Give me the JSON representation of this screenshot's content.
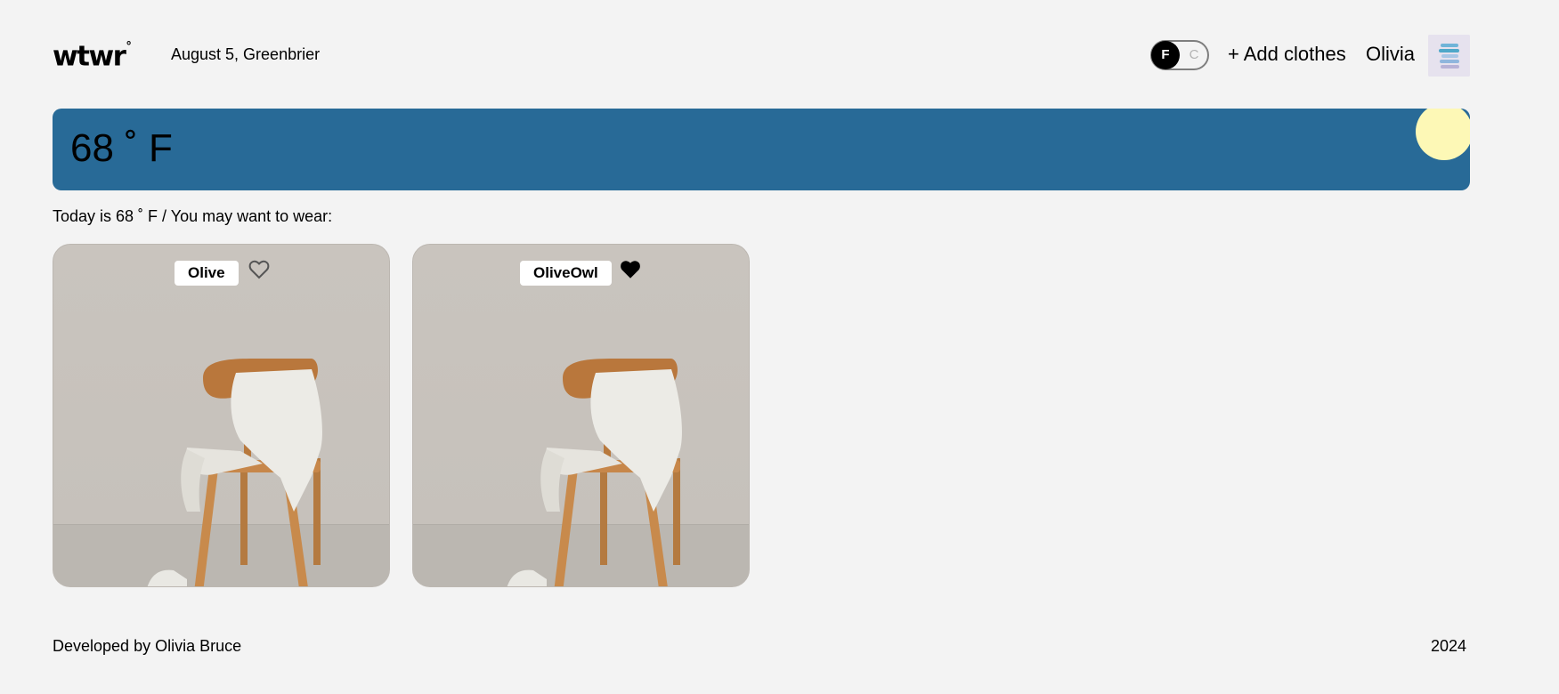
{
  "header": {
    "logo": "wtwr",
    "logo_degree": "°",
    "date_location": "August 5, Greenbrier",
    "unit_toggle": {
      "fahrenheit": "F",
      "celsius": "C",
      "selected": "F"
    },
    "add_clothes": "+ Add clothes",
    "username": "Olivia"
  },
  "weather": {
    "temperature_display": "68 ˚ F",
    "condition_icon": "sun-icon"
  },
  "main": {
    "recommendation": "Today is 68 ˚ F / You may want to wear:",
    "cards": [
      {
        "name": "Olive",
        "liked": false
      },
      {
        "name": "OliveOwl",
        "liked": true
      }
    ]
  },
  "footer": {
    "credit": "Developed by Olivia Bruce",
    "year": "2024"
  },
  "colors": {
    "background": "#f3f3f3",
    "banner": "#286a97",
    "sun": "#fdf8b6",
    "toggle_active": "#000000"
  }
}
